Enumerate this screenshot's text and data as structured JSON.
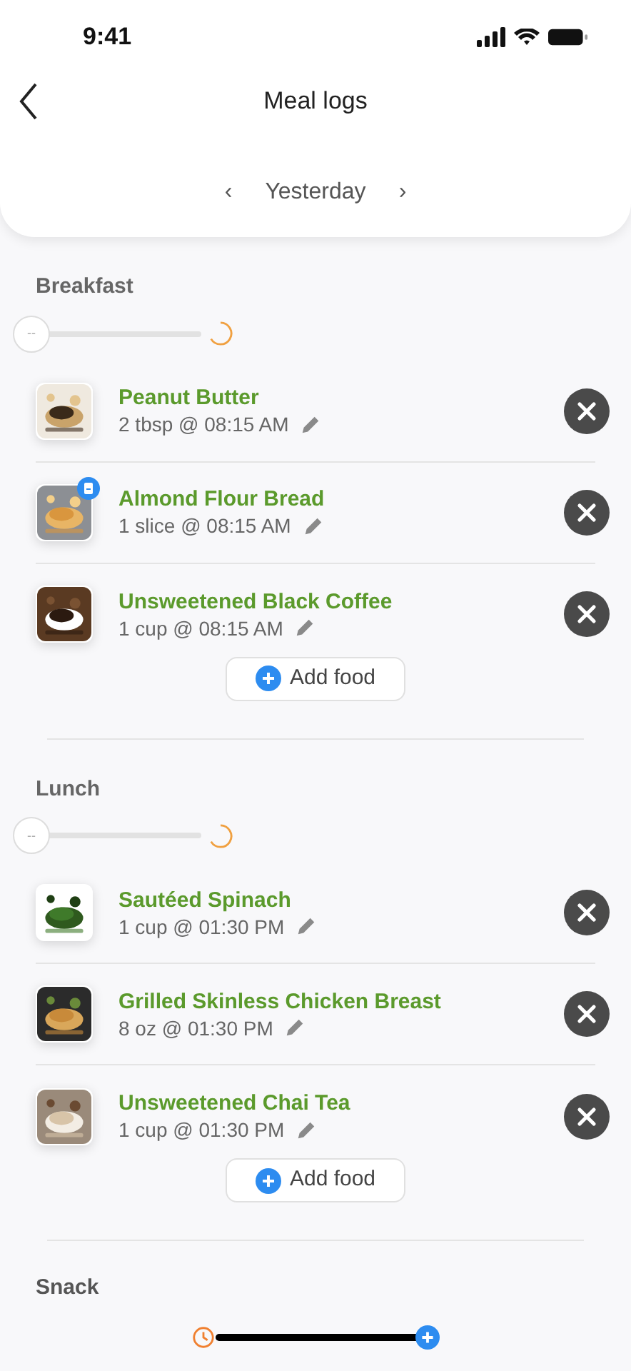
{
  "status_bar": {
    "time": "9:41"
  },
  "header": {
    "title": "Meal logs"
  },
  "date_nav": {
    "prev": "‹",
    "label": "Yesterday",
    "next": "›"
  },
  "sections": [
    {
      "title": "Breakfast",
      "slider": {
        "value": "--",
        "level": 0
      },
      "items": [
        {
          "name": "Peanut Butter",
          "detail": "2 tbsp @ 08:15 AM",
          "badge": false
        },
        {
          "name": "Almond Flour Bread",
          "detail": "1 slice @ 08:15 AM",
          "badge": true
        },
        {
          "name": "Unsweetened Black Coffee",
          "detail": "1 cup @ 08:15 AM",
          "badge": false
        }
      ],
      "add_label": "Add food"
    },
    {
      "title": "Lunch",
      "slider": {
        "value": "--",
        "level": 0
      },
      "items": [
        {
          "name": "Sautéed Spinach",
          "detail": "1 cup @ 01:30 PM",
          "badge": false
        },
        {
          "name": "Grilled Skinless Chicken Breast",
          "detail": "8 oz @ 01:30 PM",
          "badge": false
        },
        {
          "name": "Unsweetened Chai Tea",
          "detail": "1 cup @ 01:30 PM",
          "badge": false
        }
      ],
      "add_label": "Add food"
    }
  ],
  "snack": {
    "title": "Snack"
  }
}
